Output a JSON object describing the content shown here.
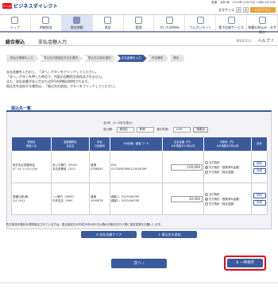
{
  "header": {
    "logo_mark": "かんぽ",
    "logo_text": "ビジネスダイレクト",
    "user_line": "愛媛　太郎 様　2014年12月20日 15時15分15秒",
    "font_size_label": "文字サイズ",
    "font_small": "小",
    "font_large": "大",
    "logout": "ログアウト"
  },
  "nav": [
    {
      "label": "トップ",
      "active": false
    },
    {
      "label": "明細照会",
      "active": false
    },
    {
      "label": "資金移動",
      "active": true
    },
    {
      "label": "承認",
      "active": false
    },
    {
      "label": "管理",
      "active": false
    },
    {
      "label": "がいためWeb",
      "active": false
    },
    {
      "label": "でんさいネット",
      "active": false
    },
    {
      "label": "電子記録サービス",
      "active": false
    },
    {
      "label": "各種お申込み・お手続き",
      "active": false
    }
  ],
  "page": {
    "title": "総合振込",
    "subtitle": "支払金額入力",
    "page_id": "BSOF013",
    "help": "ヘルプ ?"
  },
  "steps": [
    "振込元情報を入力",
    "振込先口座指定方法を選択",
    "振込先口座を選択",
    "支払金額を入力",
    "内容確認",
    "確定"
  ],
  "intro": [
    "支払金額を入力の上、「次へ」ボタンをクリックしてください。",
    "「次へ」ボタンを押した時点で、内容の自動的な保存はされません。",
    "また、支払金額が未入力または0円の明細は削除されます。",
    "振込先を追加する場合は、「振込先の追加」ボタンをクリックしてください。"
  ],
  "section_title": "振込先一覧",
  "count": "全2件（1～2件を表示）",
  "sort": {
    "label": "並び順：",
    "order_value": "登録名",
    "direction_value": "昇順",
    "per_page_label": "表示件数：",
    "per_page_value": "10件",
    "redisplay": "再表示"
  },
  "table": {
    "headers": [
      "登録名\n受取人名",
      "金融機関名\n支店名",
      "科目\n口座番号",
      "EDI情報／顧客コード",
      "支払金額（円）\n※半角数字12桁以内",
      "手数料（円）\n※半角数字4桁以内",
      "操作"
    ],
    "rows": [
      {
        "name": "株式会社愛媛商会\nｶﾌﾞｼｷｶﾞｲｼｬｴﾋﾒｼｮｳｶｲ",
        "bank": "あいち銀行（0542）\n本店営業部（201）",
        "account": "普通\n0768450",
        "edi": "EDI：\n01234567890123456789",
        "amount": "100,000",
        "fee_options": [
          "当方負担",
          "先方負担（登録済み金額）",
          "先方負担（指定金額）"
        ],
        "fee_selected": 1,
        "ops": [
          "削除",
          "詳細"
        ]
      },
      {
        "name": "愛媛日産(株)\nｴﾋﾒﾆｯｻﾝ(ｶ",
        "bank": "○○銀行（9999）\n中央支店（999）",
        "account": "普通\n1990878",
        "edi": "顧客1：0123456789\n顧客2：0123456789",
        "amount": "20,000",
        "fee_options": [
          "当方負担",
          "先方負担（登録済み金額）",
          "先方負担（指定金額）"
        ],
        "fee_selected": 1,
        "ops": [
          "削除",
          "詳細"
        ]
      }
    ]
  },
  "note": "先方負担手数料を規則設定されている方は、振込指定日が平成26年4月1日以降のお取引を行う際に設定変更をお願いします。",
  "buttons": {
    "clear": "支払金額クリア",
    "add": "振込先の追加",
    "next": "次へ",
    "save": "一時保存"
  },
  "colors": {
    "primary": "#3a5a9c",
    "logo_red": "#e60012",
    "logout": "#e8a43c",
    "highlight": "#e60012"
  }
}
